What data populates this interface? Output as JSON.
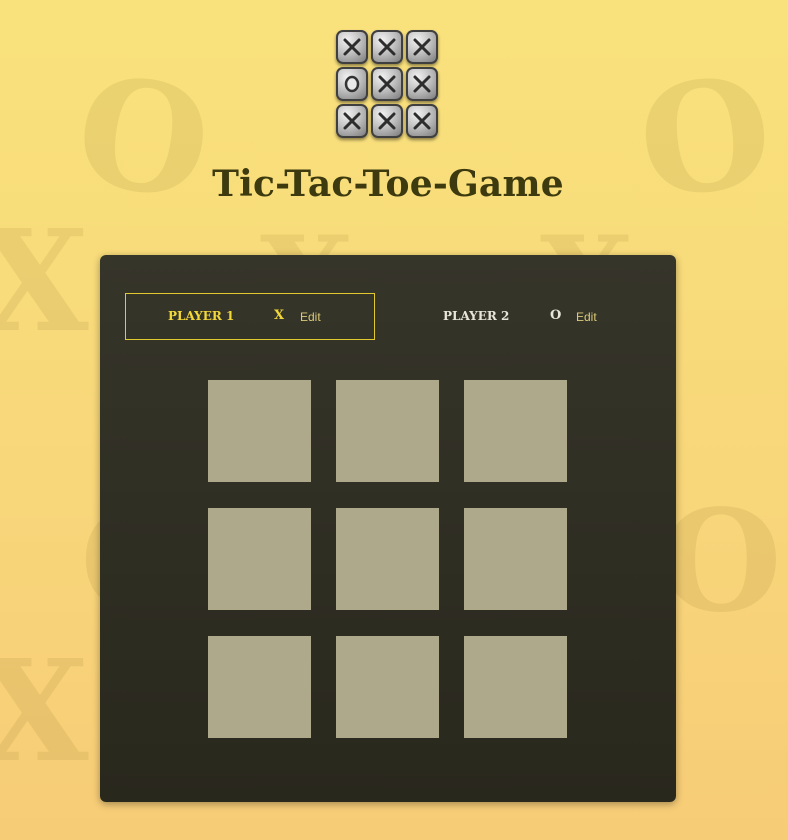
{
  "title": "Tic-Tac-Toe-Game",
  "players": [
    {
      "name": "PLAYER 1",
      "symbol": "X",
      "edit_label": "Edit",
      "active": true
    },
    {
      "name": "PLAYER 2",
      "symbol": "O",
      "edit_label": "Edit",
      "active": false
    }
  ],
  "board": {
    "cells": [
      "",
      "",
      "",
      "",
      "",
      "",
      "",
      "",
      ""
    ]
  },
  "logo": {
    "tiles": [
      "x-icon",
      "x-icon",
      "x-icon",
      "o-icon",
      "x-icon",
      "x-icon",
      "x-icon",
      "x-icon",
      "x-icon"
    ]
  },
  "colors": {
    "background": "#f9e27c",
    "panel": "#2f2e23",
    "active_accent": "#f3d83a",
    "cell": "#aea98a",
    "title": "#3c3a0e"
  }
}
